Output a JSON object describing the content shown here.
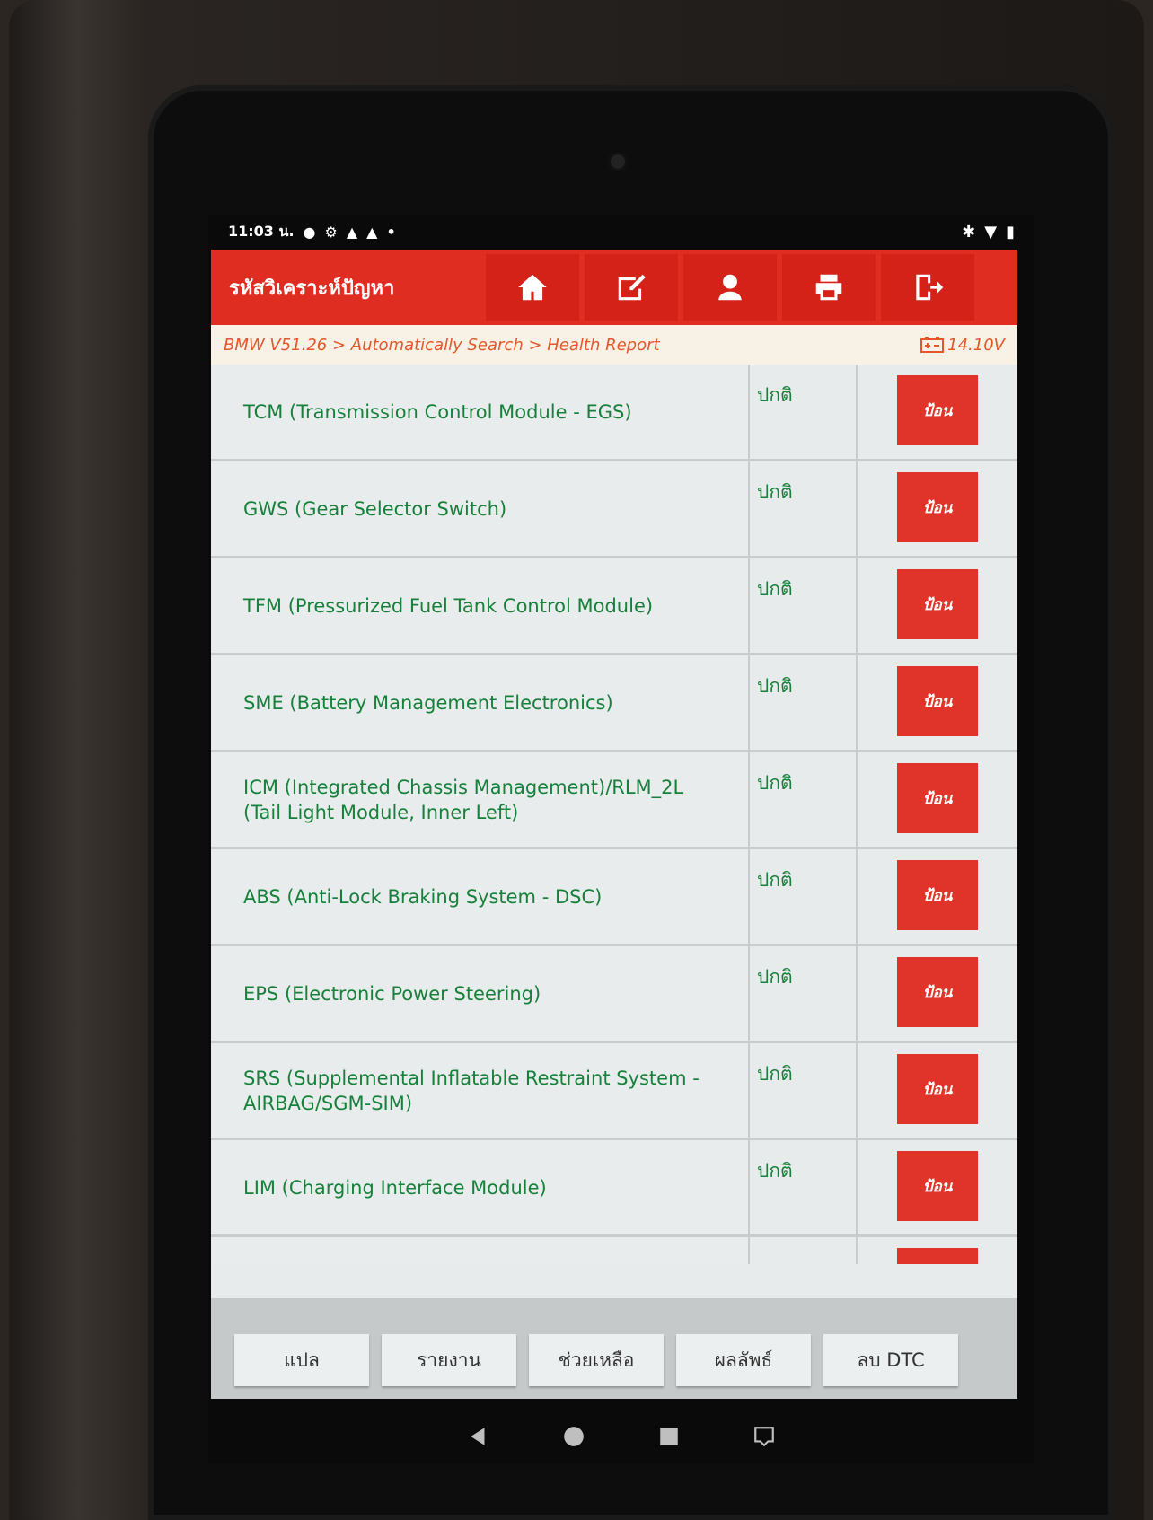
{
  "status_bar": {
    "time": "11:03 น.",
    "left_icons": [
      "notification-icon",
      "settings-notification-icon",
      "warning-icon",
      "warning-icon",
      "dot-icon"
    ],
    "right_icons": [
      "bluetooth-icon",
      "wifi-icon",
      "battery-icon"
    ]
  },
  "header": {
    "title": "รหัสวิเคราะห์ปัญหา",
    "buttons": [
      "home-icon",
      "edit-icon",
      "user-icon",
      "print-icon",
      "exit-icon"
    ]
  },
  "breadcrumb": {
    "path": "BMW V51.26 > Automatically Search > Health Report",
    "voltage": "14.10V"
  },
  "modules": [
    {
      "name": "TCM (Transmission Control Module - EGS)",
      "status": "ปกติ",
      "action": "ป้อน"
    },
    {
      "name": "GWS (Gear Selector Switch)",
      "status": "ปกติ",
      "action": "ป้อน"
    },
    {
      "name": "TFM (Pressurized Fuel Tank Control Module)",
      "status": "ปกติ",
      "action": "ป้อน"
    },
    {
      "name": "SME (Battery Management Electronics)",
      "status": "ปกติ",
      "action": "ป้อน"
    },
    {
      "name": "ICM (Integrated Chassis Management)/RLM_2L (Tail Light Module, Inner Left)",
      "status": "ปกติ",
      "action": "ป้อน"
    },
    {
      "name": "ABS (Anti-Lock Braking System - DSC)",
      "status": "ปกติ",
      "action": "ป้อน"
    },
    {
      "name": "EPS (Electronic Power Steering)",
      "status": "ปกติ",
      "action": "ป้อน"
    },
    {
      "name": "SRS (Supplemental Inflatable Restraint System - AIRBAG/SGM-SIM)",
      "status": "ปกติ",
      "action": "ป้อน"
    },
    {
      "name": "LIM (Charging Interface Module)",
      "status": "ปกติ",
      "action": "ป้อน"
    }
  ],
  "footer": {
    "buttons": [
      "แปล",
      "รายงาน",
      "ช่วยเหลือ",
      "ผลลัพธ์",
      "ลบ DTC"
    ]
  },
  "colors": {
    "header_red": "#e02d22",
    "text_green": "#17813b",
    "breadcrumb_orange": "#e4572b"
  }
}
